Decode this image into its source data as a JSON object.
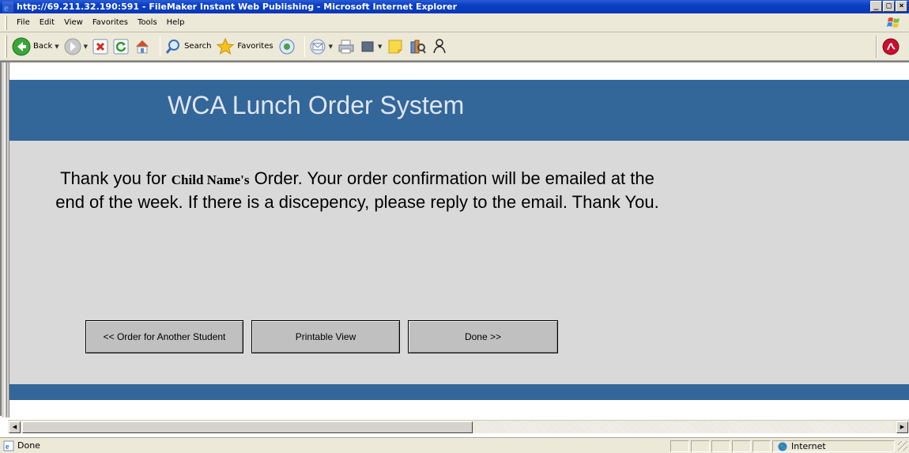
{
  "window": {
    "title": "http://69.211.32.190:591 - FileMaker Instant Web Publishing - Microsoft Internet Explorer",
    "controls": [
      "_",
      "□",
      "×"
    ]
  },
  "menu": [
    "File",
    "Edit",
    "View",
    "Favorites",
    "Tools",
    "Help"
  ],
  "toolbar": {
    "back_label": "Back",
    "search_label": "Search",
    "favorites_label": "Favorites"
  },
  "page": {
    "header_title": "WCA Lunch Order System",
    "message_prefix": "Thank you for ",
    "child_name": "Child Name's",
    "message_suffix": " Order. Your order confirmation will be emailed at the end of the week. If there is a discepency, please reply to the email. Thank You.",
    "buttons": {
      "another_student": "<< Order for Another Student",
      "printable_view": "Printable View",
      "done": "Done >>"
    }
  },
  "colors": {
    "header": "#336699",
    "content": "#d9d9d9",
    "button": "#c0c0c0"
  },
  "status": {
    "text": "Done",
    "zone": "Internet"
  }
}
